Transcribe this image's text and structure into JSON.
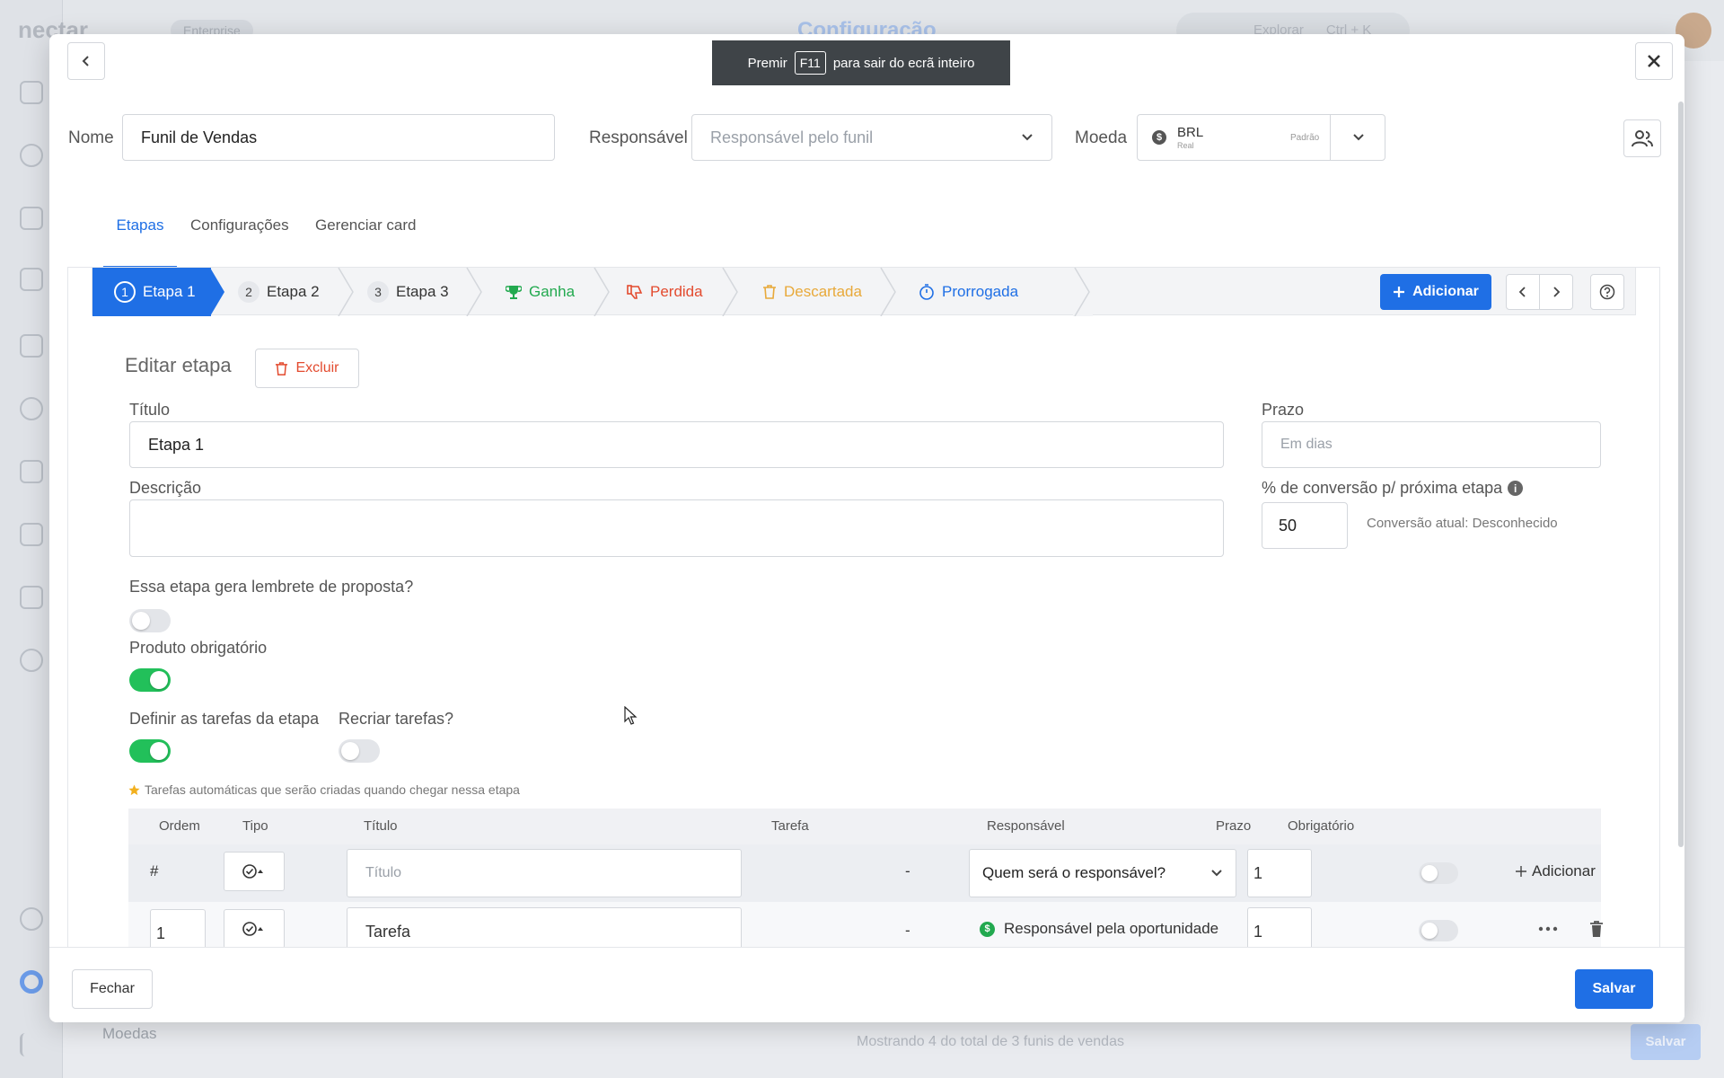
{
  "background": {
    "logo": "nectar",
    "badge": "Enterprise",
    "page_title": "Configuração",
    "search_placeholder": "Explorar",
    "search_shortcut": "Ctrl + K",
    "moedas_label": "Moedas",
    "showing_text": "Mostrando 4 do total de 3 funis de vendas",
    "save_label": "Salvar"
  },
  "fullscreen_toast": {
    "prefix": "Premir",
    "key": "F11",
    "suffix": "para sair do ecrã inteiro"
  },
  "header": {
    "name_label": "Nome",
    "name_value": "Funil de Vendas",
    "responsavel_label": "Responsável",
    "responsavel_placeholder": "Responsável pelo funil",
    "moeda_label": "Moeda",
    "currency_code": "BRL",
    "currency_name": "Real",
    "currency_tag": "Padrão"
  },
  "tabs": [
    {
      "label": "Etapas",
      "active": true
    },
    {
      "label": "Configurações",
      "active": false
    },
    {
      "label": "Gerenciar card",
      "active": false
    }
  ],
  "stages": [
    {
      "num": "1",
      "label": "Etapa 1",
      "active": true
    },
    {
      "num": "2",
      "label": "Etapa 2"
    },
    {
      "num": "3",
      "label": "Etapa 3"
    },
    {
      "label": "Ganha",
      "color": "#22a94f",
      "icon": "trophy-icon"
    },
    {
      "label": "Perdida",
      "color": "#e34b2f",
      "icon": "thumbs-down-icon"
    },
    {
      "label": "Descartada",
      "color": "#e8a93a",
      "icon": "trash-icon"
    },
    {
      "label": "Prorrogada",
      "color": "#1f6fe5",
      "icon": "stopwatch-icon"
    }
  ],
  "stage_toolbar": {
    "add_label": "Adicionar"
  },
  "edit": {
    "title": "Editar etapa",
    "delete_label": "Excluir",
    "titulo_label": "Título",
    "titulo_value": "Etapa 1",
    "prazo_label": "Prazo",
    "prazo_placeholder": "Em dias",
    "descricao_label": "Descrição",
    "conversao_label": "% de conversão p/ próxima etapa",
    "conversao_value": "50",
    "conversao_atual": "Conversão atual: Desconhecido",
    "lembrete_label": "Essa etapa gera lembrete de proposta?",
    "lembrete_on": false,
    "produto_label": "Produto obrigatório",
    "produto_on": true,
    "tarefas_label": "Definir as tarefas da etapa",
    "tarefas_on": true,
    "recriar_label": "Recriar tarefas?",
    "recriar_on": false,
    "hint": "Tarefas automáticas que serão criadas quando chegar nessa etapa"
  },
  "table": {
    "headers": [
      "Ordem",
      "Tipo",
      "Título",
      "Tarefa",
      "Responsável",
      "Prazo",
      "Obrigatório"
    ],
    "new_row": {
      "order": "#",
      "title_placeholder": "Título",
      "tarefa": "-",
      "responsavel": "Quem será o responsável?",
      "prazo": "1",
      "add_label": "Adicionar"
    },
    "rows": [
      {
        "order": "1",
        "title": "Tarefa",
        "tarefa": "-",
        "responsavel": "Responsável pela oportunidade",
        "prazo": "1"
      }
    ]
  },
  "footer": {
    "close_label": "Fechar",
    "save_label": "Salvar"
  },
  "colors": {
    "accent": "#1f6fe5",
    "success": "#22c05a",
    "danger": "#e34b2f"
  }
}
